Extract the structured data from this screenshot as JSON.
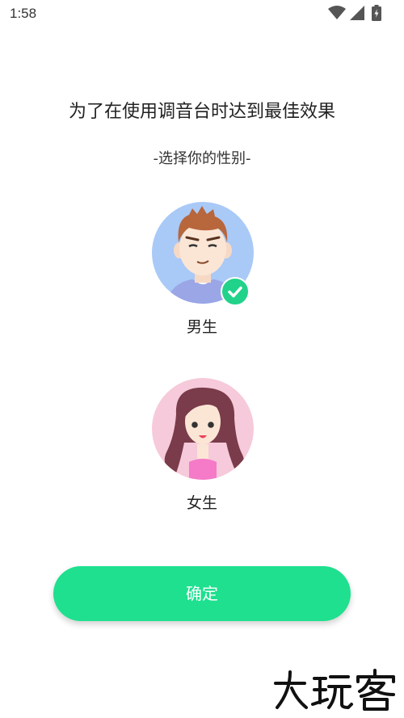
{
  "status_bar": {
    "time": "1:58",
    "icons": [
      "wifi-icon",
      "cellular-signal-icon",
      "battery-icon"
    ]
  },
  "headline": "为了在使用调音台时达到最佳效果",
  "subtitle": "-选择你的性别-",
  "gender_options": [
    {
      "label": "男生",
      "selected": true,
      "avatar_color": "#a9c9f7"
    },
    {
      "label": "女生",
      "selected": false,
      "avatar_color": "#f6cada"
    }
  ],
  "confirm_button": {
    "label": "确定",
    "color": "#1ee08f"
  },
  "accent_color": "#21d28a",
  "watermark": {
    "text": "大玩客"
  }
}
